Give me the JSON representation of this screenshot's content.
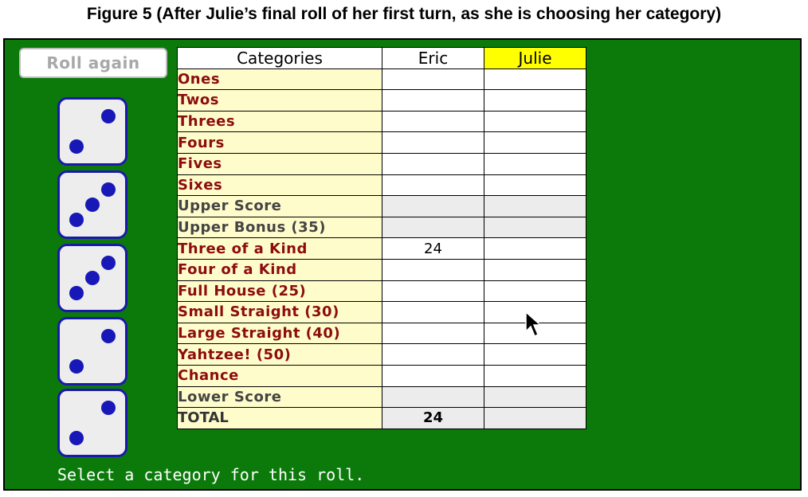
{
  "caption": "Figure 5 (After Julie’s final roll of her first turn, as she is choosing her category)",
  "roll_button": "Roll again",
  "dice": [
    2,
    3,
    3,
    2,
    2
  ],
  "scorecard": {
    "header": {
      "categories": "Categories",
      "players": [
        "Eric",
        "Julie"
      ],
      "active_player": "Julie"
    },
    "rows": [
      {
        "label": "Ones",
        "type": "category",
        "scores": [
          "",
          ""
        ]
      },
      {
        "label": "Twos",
        "type": "category",
        "scores": [
          "",
          ""
        ]
      },
      {
        "label": "Threes",
        "type": "category",
        "scores": [
          "",
          ""
        ]
      },
      {
        "label": "Fours",
        "type": "category",
        "scores": [
          "",
          ""
        ]
      },
      {
        "label": "Fives",
        "type": "category",
        "scores": [
          "",
          ""
        ]
      },
      {
        "label": "Sixes",
        "type": "category",
        "scores": [
          "",
          ""
        ]
      },
      {
        "label": "Upper Score",
        "type": "sum",
        "scores": [
          "",
          ""
        ]
      },
      {
        "label": "Upper Bonus (35)",
        "type": "sum",
        "scores": [
          "",
          ""
        ]
      },
      {
        "label": "Three of a Kind",
        "type": "category",
        "scores": [
          "24",
          ""
        ]
      },
      {
        "label": "Four of a Kind",
        "type": "category",
        "scores": [
          "",
          ""
        ]
      },
      {
        "label": "Full House (25)",
        "type": "category",
        "scores": [
          "",
          ""
        ]
      },
      {
        "label": "Small Straight (30)",
        "type": "category",
        "scores": [
          "",
          ""
        ]
      },
      {
        "label": "Large Straight (40)",
        "type": "category",
        "scores": [
          "",
          ""
        ]
      },
      {
        "label": "Yahtzee! (50)",
        "type": "category",
        "scores": [
          "",
          ""
        ]
      },
      {
        "label": "Chance",
        "type": "category",
        "scores": [
          "",
          ""
        ]
      },
      {
        "label": "Lower Score",
        "type": "sum",
        "scores": [
          "",
          ""
        ]
      },
      {
        "label": "TOTAL",
        "type": "total",
        "scores": [
          "24",
          ""
        ]
      }
    ]
  },
  "status": "Select a category for this roll.",
  "colors": {
    "board": "#0b7a0b",
    "category_bg": "#fffccc",
    "category_text": "#8b0d0d",
    "active_player_bg": "#ffff00",
    "pip": "#1818b8"
  }
}
